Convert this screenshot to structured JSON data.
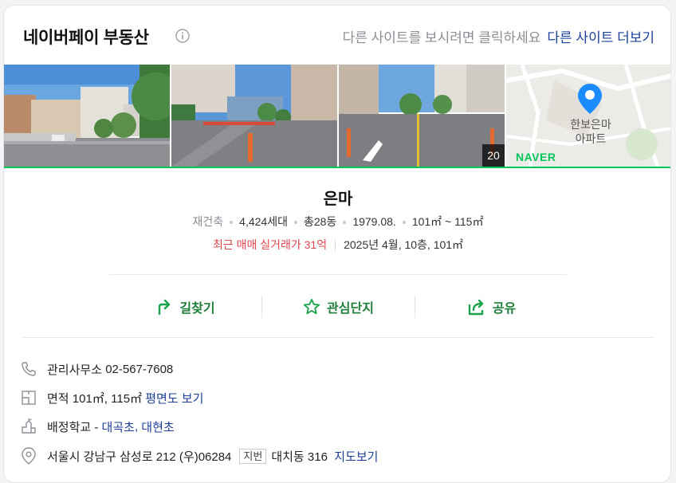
{
  "header": {
    "title": "네이버페이 부동산",
    "other_site_desc": "다른 사이트를 보시려면 클릭하세요",
    "other_site_link": "다른 사이트 더보기"
  },
  "photos": {
    "count": "20",
    "map_label_line1": "한보은마",
    "map_label_line2": "아파트",
    "map_brand": "NAVER"
  },
  "apartment": {
    "name": "은마",
    "type": "재건축",
    "households": "4,424세대",
    "buildings": "총28동",
    "built": "1979.08.",
    "area_range": "101㎡ ~ 115㎡",
    "recent_price": "최근 매매 실거래가 31억",
    "recent_detail": "2025년 4월, 10층, 101㎡"
  },
  "actions": {
    "directions": "길찾기",
    "favorite": "관심단지",
    "share": "공유"
  },
  "info": {
    "office_label": "관리사무소",
    "office_phone": "02-567-7608",
    "area_label": "면적",
    "area_value": "101㎡, 115㎡",
    "floorplan_link": "평면도 보기",
    "school_label": "배정학교 -",
    "school_1": "대곡초",
    "school_sep": ",",
    "school_2": "대현초",
    "address": "서울시 강남구 삼성로 212 (우)06284",
    "lot_tag": "지번",
    "lot_address": "대치동 316",
    "map_link": "지도보기"
  },
  "colors": {
    "brand_green": "#03c75a",
    "action_green": "#1f7f3a",
    "link_blue": "#1c3f9b",
    "price_red": "#e0484f"
  }
}
